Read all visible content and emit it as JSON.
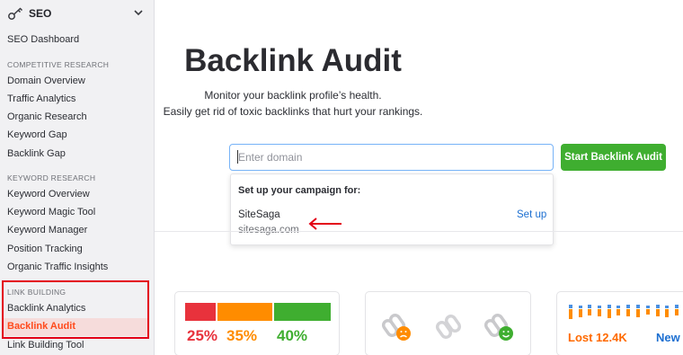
{
  "sidebar": {
    "title": "SEO",
    "items_top": [
      {
        "label": "SEO Dashboard"
      }
    ],
    "competitive_research": {
      "heading": "COMPETITIVE RESEARCH",
      "items": [
        "Domain Overview",
        "Traffic Analytics",
        "Organic Research",
        "Keyword Gap",
        "Backlink Gap"
      ]
    },
    "keyword_research": {
      "heading": "KEYWORD RESEARCH",
      "items": [
        "Keyword Overview",
        "Keyword Magic Tool",
        "Keyword Manager",
        "Position Tracking",
        "Organic Traffic Insights"
      ]
    },
    "link_building": {
      "heading": "LINK BUILDING",
      "items": [
        "Backlink Analytics",
        "Backlink Audit",
        "Link Building Tool"
      ],
      "active": "Backlink Audit"
    },
    "active_color": "#ff4a1c"
  },
  "main": {
    "title": "Backlink Audit",
    "subtitle_line1": "Monitor your backlink profile’s health.",
    "subtitle_line2": "Easily get rid of toxic backlinks that hurt your rankings.",
    "input_placeholder": "Enter domain",
    "start_button": "Start Backlink Audit",
    "dropdown": {
      "heading": "Set up your campaign for:",
      "project_name": "SiteSaga",
      "project_domain": "sitesaga.com",
      "action": "Set up"
    }
  },
  "cards": {
    "toxicity": {
      "segments": [
        {
          "label": "25%",
          "color": "#e8323c"
        },
        {
          "label": "35%",
          "color": "#ff8c00"
        },
        {
          "label": "40%",
          "color": "#3fae30"
        }
      ]
    },
    "links": {
      "icons": [
        "toxic-link-icon",
        "neutral-link-icon",
        "healthy-link-icon"
      ]
    },
    "lost_new": {
      "lost_label": "Lost 12.4K",
      "new_label": "New"
    }
  },
  "colors": {
    "button_green": "#3fae30",
    "link_blue": "#1c6fd1",
    "highlight_red": "#e30016"
  }
}
